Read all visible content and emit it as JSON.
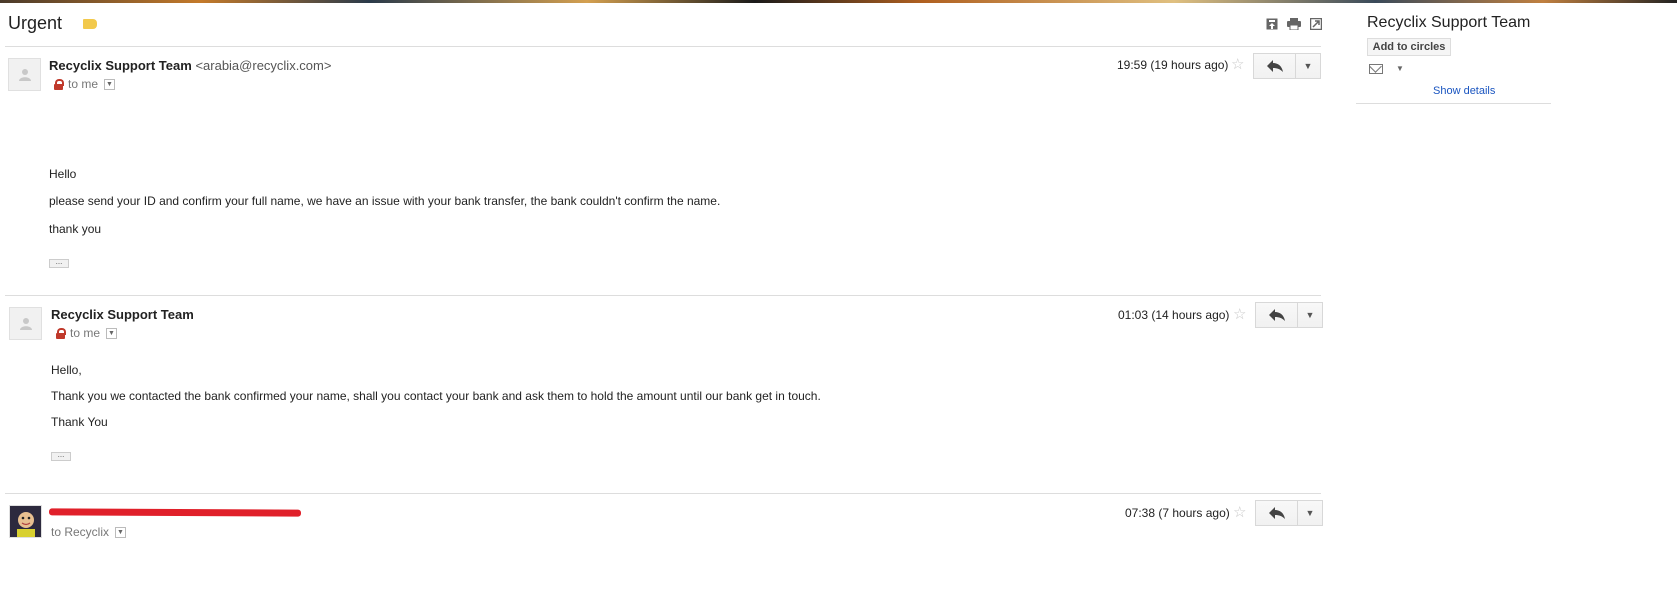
{
  "thread": {
    "subject": "Urgent"
  },
  "messages": [
    {
      "sender_name": "Recyclix Support Team",
      "sender_email": "<arabia@recyclix.com>",
      "recipient": "to me",
      "time": "19:59 (19 hours ago)",
      "body": [
        "Hello",
        "please send your ID and confirm your full name, we have an issue with your bank transfer, the bank couldn't confirm the name.",
        "thank you"
      ]
    },
    {
      "sender_name": "Recyclix Support Team",
      "recipient": "to me",
      "time": "01:03 (14 hours ago)",
      "body": [
        "Hello,",
        "Thank you we contacted the bank confirmed your name, shall you contact your bank and ask them to hold the amount until our bank get in touch.",
        "Thank You"
      ]
    },
    {
      "recipient": "to Recyclix",
      "time": "07:38 (7 hours ago)"
    }
  ],
  "contact_panel": {
    "name": "Recyclix Support Team",
    "add_to_circles": "Add to circles",
    "show_details": "Show details"
  },
  "icons": {
    "archive": "archive-icon",
    "print": "print-icon",
    "new_window": "new-window-icon",
    "star": "star-icon",
    "reply": "reply-icon",
    "more": "chevron-down-icon",
    "lock": "lock-icon",
    "mail": "mail-icon"
  },
  "colors": {
    "label": "#f2c94c",
    "link": "#1a55c0",
    "redaction": "#e0202a",
    "lock": "#c0392b"
  }
}
